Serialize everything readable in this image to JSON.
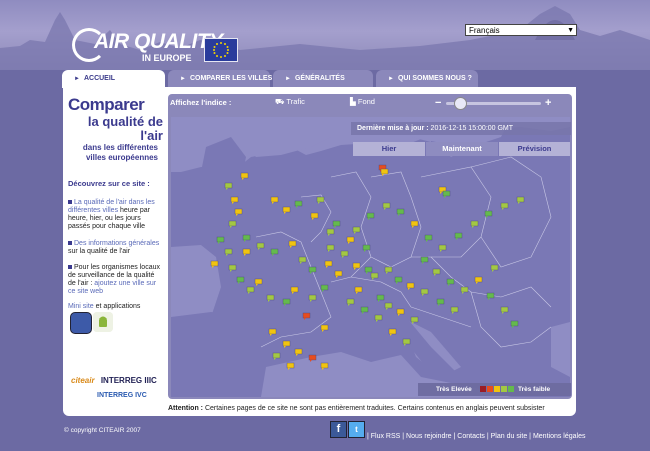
{
  "brand": {
    "title": "AIR QUALITY",
    "subtitle": "IN EUROPE"
  },
  "language": {
    "selected": "Français"
  },
  "nav": {
    "tabs": [
      {
        "label": "ACCUEIL",
        "active": true
      },
      {
        "label": "COMPARER LES VILLES",
        "active": false
      },
      {
        "label": "GÉNÉRALITÉS",
        "active": false
      },
      {
        "label": "QUI SOMMES NOUS ?",
        "active": false
      }
    ]
  },
  "intro": {
    "heading1": "Comparer",
    "heading2": "la qualité de l'air",
    "heading3": "dans les différentes villes européennes",
    "discover": "Découvrez sur ce site :",
    "bullet1_link": "La qualité de l'air dans les différentes villes",
    "bullet1_text": "heure par heure, hier, ou les jours passés pour chaque ville",
    "bullet2_link": "Des informations générales",
    "bullet2_text": "sur la qualité de l'air",
    "bullet3_text": "Pour les organismes locaux de surveillance de la qualité de l'air :",
    "bullet3_link": "ajoutez une ville sur ce site web",
    "mini_link": "Mini site",
    "mini_text": "et applications",
    "partner1_logo": "citeair",
    "partner1_name": "INTERREG IIIC",
    "partner2_name": "INTERREG IVC"
  },
  "map": {
    "indice_label": "Affichez l'indice :",
    "trafic_label": "Trafic",
    "fond_label": "Fond",
    "zoom_minus": "−",
    "zoom_plus": "+",
    "zoom_level": 0.15,
    "update_label": "Dernière mise à jour :",
    "update_value": "2016-12-15 15:00:00 GMT",
    "time_tabs": [
      "Hier",
      "Maintenant",
      "Prévision"
    ],
    "time_selected": "Maintenant",
    "legend_high": "Très Elevée",
    "legend_low": "Très faible",
    "colors": {
      "water": "#8f8dc4",
      "land": "#7a78b5",
      "border": "#c9c8e6",
      "very_high": "#9b1c25",
      "high": "#e74c1e",
      "medium": "#f1c40f",
      "low": "#a3c842",
      "very_low": "#64ba4c"
    }
  },
  "notice": {
    "label": "Attention :",
    "text": "Certaines pages de ce site ne sont pas entièrement traduites. Certains contenus en anglais peuvent subsister"
  },
  "footer": {
    "copyright": "© copyright CITEAIR 2007",
    "links": [
      "Flux RSS",
      "Nous rejoindre",
      "Contacts",
      "Plan du site",
      "Mentions légales"
    ]
  }
}
